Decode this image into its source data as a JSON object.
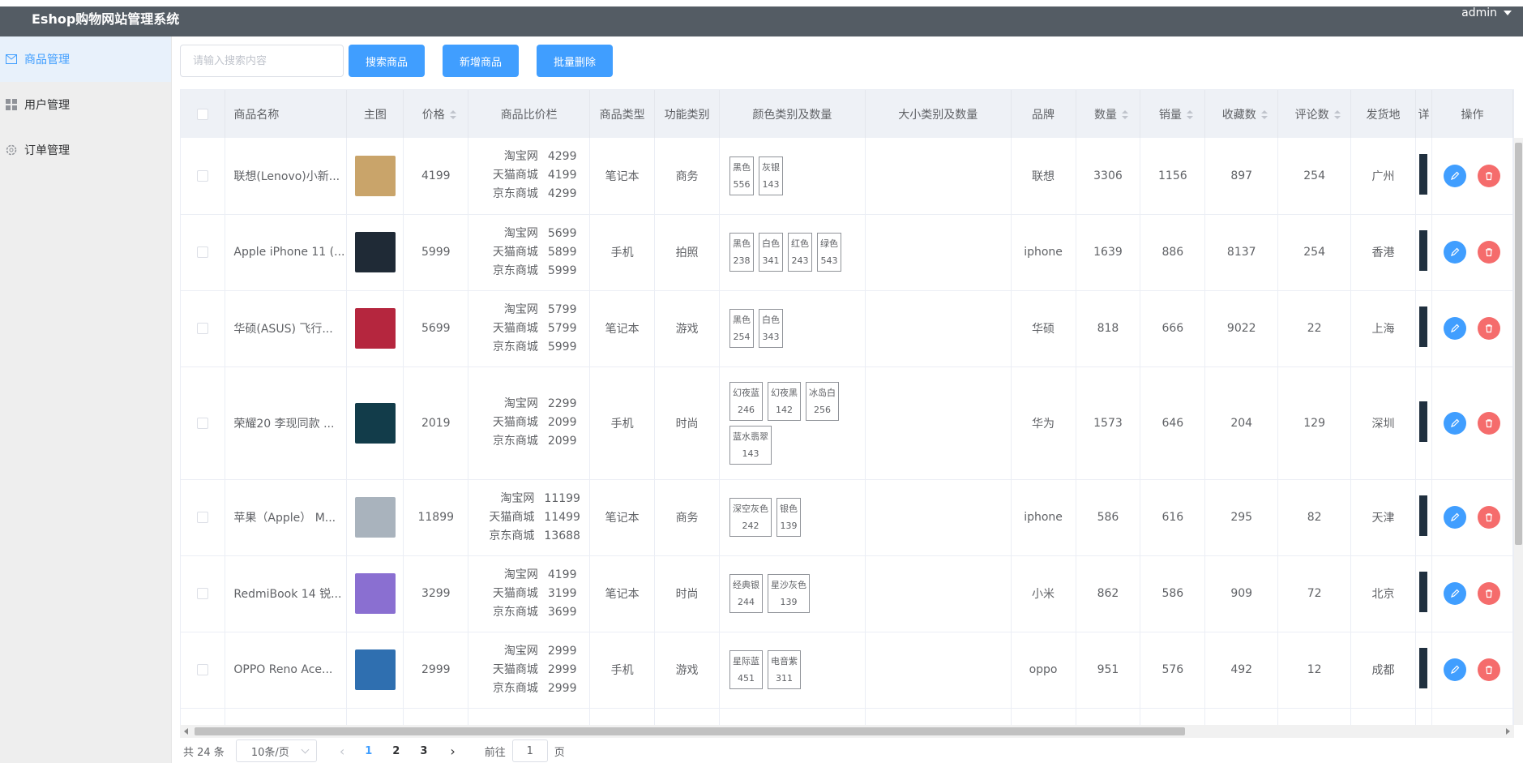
{
  "app_title": "Eshop购物网站管理系统",
  "user": "admin",
  "sidebar": {
    "items": [
      {
        "label": "商品管理",
        "icon": "envelope-icon",
        "active": true
      },
      {
        "label": "用户管理",
        "icon": "grid-icon",
        "active": false
      },
      {
        "label": "订单管理",
        "icon": "gear-icon",
        "active": false
      }
    ]
  },
  "toolbar": {
    "search_placeholder": "请输入搜索内容",
    "search_label": "搜索商品",
    "add_label": "新增商品",
    "batch_delete_label": "批量删除"
  },
  "table": {
    "headers": [
      "商品名称",
      "主图",
      "价格",
      "商品比价栏",
      "商品类型",
      "功能类别",
      "颜色类别及数量",
      "大小类别及数量",
      "品牌",
      "数量",
      "销量",
      "收藏数",
      "评论数",
      "发货地",
      "详",
      "操作"
    ],
    "rows": [
      {
        "name": "联想(Lenovo)小新...",
        "price": "4199",
        "compare": [
          [
            "淘宝网",
            "4299"
          ],
          [
            "天猫商城",
            "4199"
          ],
          [
            "京东商城",
            "4299"
          ]
        ],
        "type": "笔记本",
        "func": "商务",
        "colors": [
          [
            "黑色",
            "556"
          ],
          [
            "灰银",
            "143"
          ]
        ],
        "brand": "联想",
        "qty": "3306",
        "sales": "1156",
        "fav": "897",
        "comments": "254",
        "ship": "广州",
        "thumb": "#c9a46a"
      },
      {
        "name": "Apple iPhone 11 (...",
        "price": "5999",
        "compare": [
          [
            "淘宝网",
            "5699"
          ],
          [
            "天猫商城",
            "5899"
          ],
          [
            "京东商城",
            "5999"
          ]
        ],
        "type": "手机",
        "func": "拍照",
        "colors": [
          [
            "黑色",
            "238"
          ],
          [
            "白色",
            "341"
          ],
          [
            "红色",
            "243"
          ],
          [
            "绿色",
            "543"
          ]
        ],
        "brand": "iphone",
        "qty": "1639",
        "sales": "886",
        "fav": "8137",
        "comments": "254",
        "ship": "香港",
        "thumb": "#1f2a36"
      },
      {
        "name": "华硕(ASUS) 飞行...",
        "price": "5699",
        "compare": [
          [
            "淘宝网",
            "5799"
          ],
          [
            "天猫商城",
            "5799"
          ],
          [
            "京东商城",
            "5999"
          ]
        ],
        "type": "笔记本",
        "func": "游戏",
        "colors": [
          [
            "黑色",
            "254"
          ],
          [
            "白色",
            "343"
          ]
        ],
        "brand": "华硕",
        "qty": "818",
        "sales": "666",
        "fav": "9022",
        "comments": "22",
        "ship": "上海",
        "thumb": "#b5263e"
      },
      {
        "name": "荣耀20 李现同款 ...",
        "price": "2019",
        "compare": [
          [
            "淘宝网",
            "2299"
          ],
          [
            "天猫商城",
            "2099"
          ],
          [
            "京东商城",
            "2099"
          ]
        ],
        "type": "手机",
        "func": "时尚",
        "colors": [
          [
            "幻夜蓝",
            "246"
          ],
          [
            "幻夜黑",
            "142"
          ],
          [
            "冰岛白",
            "256"
          ],
          [
            "蓝水翡翠",
            "143"
          ]
        ],
        "brand": "华为",
        "qty": "1573",
        "sales": "646",
        "fav": "204",
        "comments": "129",
        "ship": "深圳",
        "thumb": "#123c4a"
      },
      {
        "name": "苹果（Apple） M...",
        "price": "11899",
        "compare": [
          [
            "淘宝网",
            "11199"
          ],
          [
            "天猫商城",
            "11499"
          ],
          [
            "京东商城",
            "13688"
          ]
        ],
        "type": "笔记本",
        "func": "商务",
        "colors": [
          [
            "深空灰色",
            "242"
          ],
          [
            "银色",
            "139"
          ]
        ],
        "brand": "iphone",
        "qty": "586",
        "sales": "616",
        "fav": "295",
        "comments": "82",
        "ship": "天津",
        "thumb": "#a9b3bd"
      },
      {
        "name": "RedmiBook 14 锐...",
        "price": "3299",
        "compare": [
          [
            "淘宝网",
            "4199"
          ],
          [
            "天猫商城",
            "3199"
          ],
          [
            "京东商城",
            "3699"
          ]
        ],
        "type": "笔记本",
        "func": "时尚",
        "colors": [
          [
            "经典银",
            "244"
          ],
          [
            "星沙灰色",
            "139"
          ]
        ],
        "brand": "小米",
        "qty": "862",
        "sales": "586",
        "fav": "909",
        "comments": "72",
        "ship": "北京",
        "thumb": "#8a6fd1"
      },
      {
        "name": "OPPO Reno Ace...",
        "price": "2999",
        "compare": [
          [
            "淘宝网",
            "2999"
          ],
          [
            "天猫商城",
            "2999"
          ],
          [
            "京东商城",
            "2999"
          ]
        ],
        "type": "手机",
        "func": "游戏",
        "colors": [
          [
            "星际蓝",
            "451"
          ],
          [
            "电音紫",
            "311"
          ]
        ],
        "brand": "oppo",
        "qty": "951",
        "sales": "576",
        "fav": "492",
        "comments": "12",
        "ship": "成都",
        "thumb": "#2f6fb0"
      }
    ]
  },
  "pagination": {
    "total": "共 24 条",
    "page_size": "10条/页",
    "pages": [
      "1",
      "2",
      "3"
    ],
    "current": "1",
    "goto_prefix": "前往",
    "goto_value": "1",
    "goto_suffix": "页"
  },
  "colors": {
    "topbar": "#545c64",
    "primary": "#409eff",
    "danger": "#f56c6c"
  }
}
